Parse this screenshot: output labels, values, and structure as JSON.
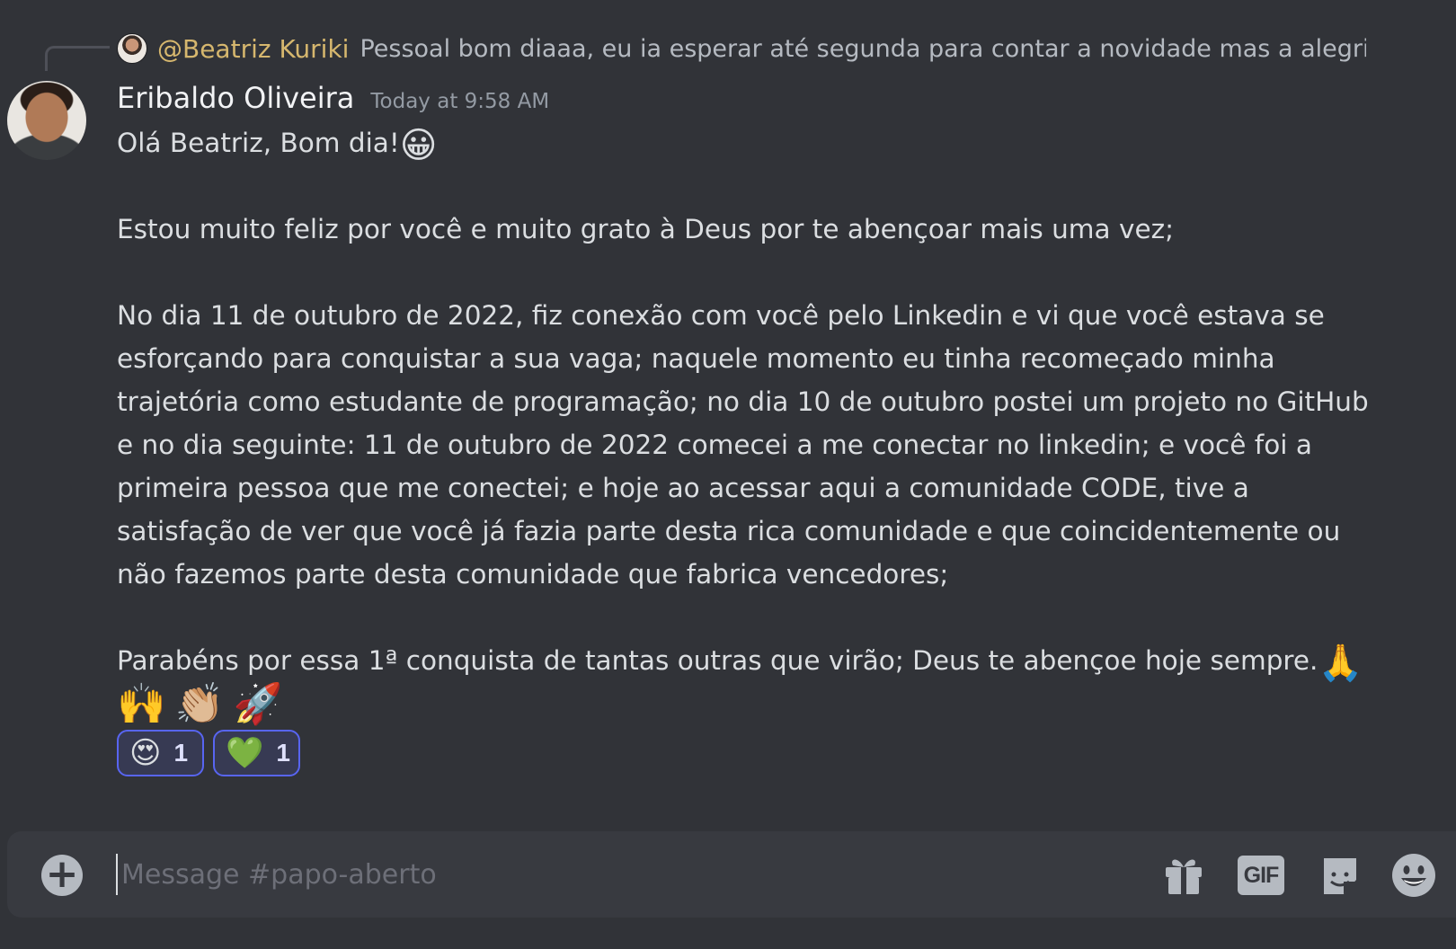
{
  "reply": {
    "author": "@Beatriz Kuriki",
    "text": "Pessoal bom diaaa, eu ia esperar até segunda para contar a novidade mas a alegria é ta"
  },
  "message": {
    "author": "Eribaldo Oliveira",
    "timestamp": "Today at 9:58 AM",
    "greeting": "Olá Beatriz, Bom dia!",
    "greeting_emoji": "😀",
    "paragraph_1": "Estou muito feliz por você e muito grato à Deus por te abençoar mais uma vez;",
    "paragraph_2": "No dia 11 de outubro de 2022, fiz conexão com você pelo Linkedin e vi que você estava se esforçando para conquistar a sua vaga; naquele momento eu tinha recomeçado minha trajetória como estudante de programação; no dia 10 de outubro postei um projeto no GitHub e no dia seguinte: 11 de outubro de 2022 comecei a me conectar no linkedin; e você foi a primeira pessoa que me conectei; e hoje ao acessar aqui a comunidade CODE, tive a satisfação de ver que você já fazia parte desta rica comunidade e que coincidentemente ou não fazemos parte desta comunidade que fabrica vencedores;",
    "paragraph_3": "Parabéns por essa 1ª conquista de tantas outras que virão; Deus te abençoe hoje sempre.",
    "paragraph_3_emoji": "🙏",
    "trailing_emojis": [
      "🙌",
      "👏🏼",
      "🚀"
    ]
  },
  "reactions": [
    {
      "emoji": "😍",
      "count": "1"
    },
    {
      "emoji": "💚",
      "count": "1"
    }
  ],
  "composer": {
    "placeholder": "Message #papo-aberto",
    "add_label": "+",
    "gif_label": "GIF"
  },
  "colors": {
    "background": "#313338",
    "composer": "#383a40",
    "reply_author": "#d6b76e",
    "reaction_border": "#5865f2"
  },
  "icons": [
    "plus-circle-icon",
    "gift-icon",
    "gif-icon",
    "sticker-icon",
    "emoji-smile-icon"
  ]
}
